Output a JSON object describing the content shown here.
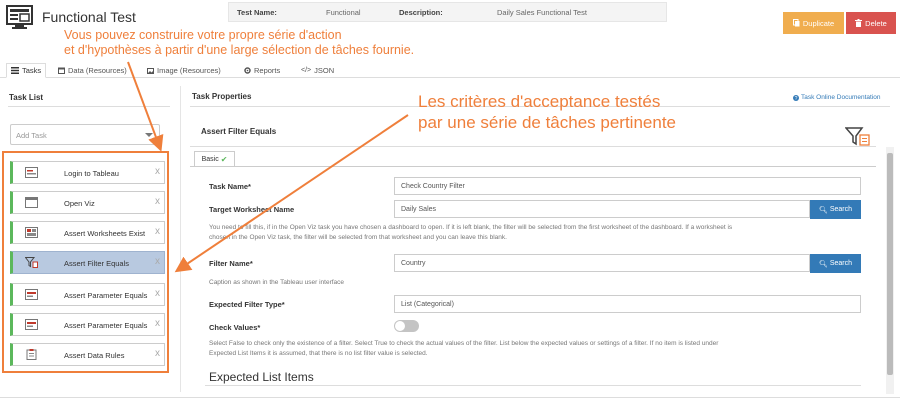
{
  "header": {
    "title": "Functional Test",
    "test_name_label": "Test Name:",
    "test_name_value": "Functional",
    "description_label": "Description:",
    "description_value": "Daily Sales Functional Test",
    "duplicate_label": "Duplicate",
    "delete_label": "Delete"
  },
  "annotations": {
    "left_line1": "Vous pouvez construire votre propre série d'action",
    "left_line2": "et d'hypothèses à partir d'une large sélection de tâches fournie.",
    "right_line1": "Les critères d'acceptance testés",
    "right_line2": "par une série de tâches pertinente",
    "color": "#ef7f3b"
  },
  "tabs": [
    {
      "label": "Tasks",
      "icon": "list-icon"
    },
    {
      "label": "Data (Resources)",
      "icon": "calendar-icon"
    },
    {
      "label": "Image (Resources)",
      "icon": "image-icon"
    },
    {
      "label": "Reports",
      "icon": "gear-icon"
    },
    {
      "label": "JSON",
      "icon": "code-icon"
    }
  ],
  "task_list": {
    "title": "Task List",
    "add_placeholder": "Add Task",
    "items": [
      {
        "label": "Login to Tableau",
        "icon": "login-icon"
      },
      {
        "label": "Open Viz",
        "icon": "window-icon"
      },
      {
        "label": "Assert Worksheets Exist",
        "icon": "worksheet-icon"
      },
      {
        "label": "Assert Filter Equals",
        "icon": "filter-icon",
        "selected": true
      },
      {
        "label": "Assert Parameter Equals",
        "icon": "parameter-icon"
      },
      {
        "label": "Assert Parameter Equals",
        "icon": "parameter-icon"
      },
      {
        "label": "Assert Data Rules",
        "icon": "clipboard-icon"
      }
    ],
    "remove_glyph": "x"
  },
  "task_properties": {
    "title": "Task Properties",
    "doc_link": "Task Online Documentation",
    "card_title": "Assert Filter Equals",
    "basic_tab": "Basic",
    "task_name_label": "Task Name*",
    "task_name_value": "Check Country Filter",
    "target_ws_label": "Target Worksheet Name",
    "target_ws_value": "Daily Sales",
    "search_label": "Search",
    "target_ws_help_1": "You need to fill this, if in the Open Viz task you have chosen a dashboard to open. If it is left blank, the filter will be selected from the first worksheet of the dashboard. If a worksheet is",
    "target_ws_help_2": "chosen in the Open Viz task, the filter will be selected from that worksheet and you can leave this blank.",
    "filter_name_label": "Filter Name*",
    "filter_name_value": "Country",
    "filter_name_help": "Caption as shown in the Tableau user interface",
    "expected_type_label": "Expected Filter Type*",
    "expected_type_value": "List (Categorical)",
    "check_values_label": "Check Values*",
    "check_values_on": false,
    "check_values_help_1": "Select False to check only the existence of a filter. Select True to check the actual values of the filter. List below the expected values or settings of a filter. If no item is listed under",
    "check_values_help_2": "Expected List Items it is assumed, that there is no list filter value is selected.",
    "expected_list_title": "Expected List Items"
  },
  "colors": {
    "duplicate": "#f0ad4e",
    "delete": "#d9534f",
    "search": "#337ab7",
    "task_accent": "#5cb85c",
    "selected_task": "#b8c9e0"
  }
}
